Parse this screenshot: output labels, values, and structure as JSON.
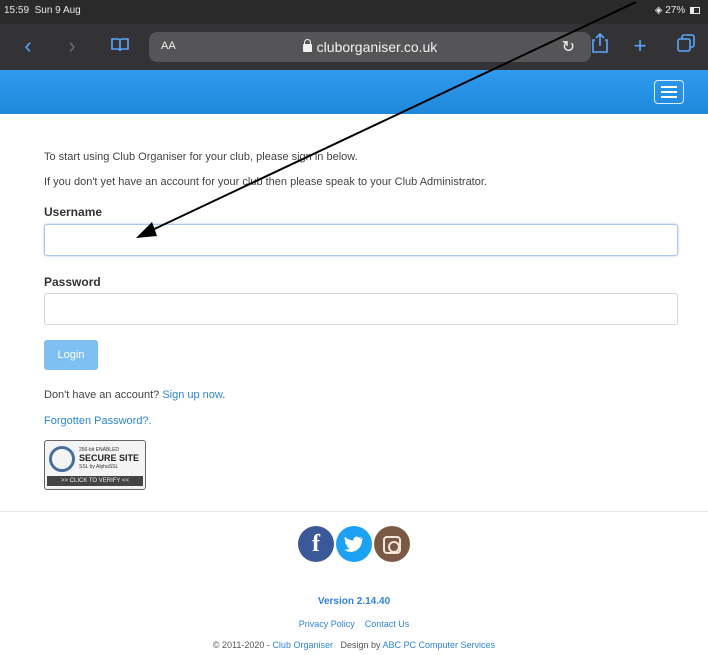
{
  "status_bar": {
    "time": "15:59",
    "date": "Sun 9 Aug",
    "battery": "27%"
  },
  "browser": {
    "reader_label": "AA",
    "url": "cluborganiser.co.uk"
  },
  "intro": {
    "line1": "To start using Club Organiser for your club, please sign in below.",
    "line2": "If you don't yet have an account for your club then please speak to your Club Administrator."
  },
  "form": {
    "username_label": "Username",
    "username_value": "",
    "password_label": "Password",
    "password_value": "",
    "login_label": "Login"
  },
  "signup": {
    "prefix": "Don't have an account?",
    "link": "Sign up now",
    "suffix": "."
  },
  "forgot_link": "Forgotten Password?.",
  "seal": {
    "line1": "256-bit ENABLED",
    "line2": "SECURE SITE",
    "line3": "SSL by AlphaSSL",
    "line4": ">> CLICK TO VERIFY <<"
  },
  "footer": {
    "version": "Version 2.14.40",
    "privacy": "Privacy Policy",
    "contact": "Contact Us",
    "copyright": "© 2011-2020 -",
    "club_link": "Club Organiser",
    "design_by": "Design by",
    "designer_link": "ABC PC Computer Services"
  },
  "colors": {
    "header": "#1f88db",
    "link": "#2f85d9",
    "login_button": "#7ec0f2"
  },
  "icons": [
    "back-icon",
    "forward-icon",
    "bookmarks-icon",
    "lock-icon",
    "reload-icon",
    "share-icon",
    "new-tab-icon",
    "tabs-icon",
    "hamburger-menu-icon",
    "facebook-icon",
    "twitter-icon",
    "instagram-icon"
  ]
}
